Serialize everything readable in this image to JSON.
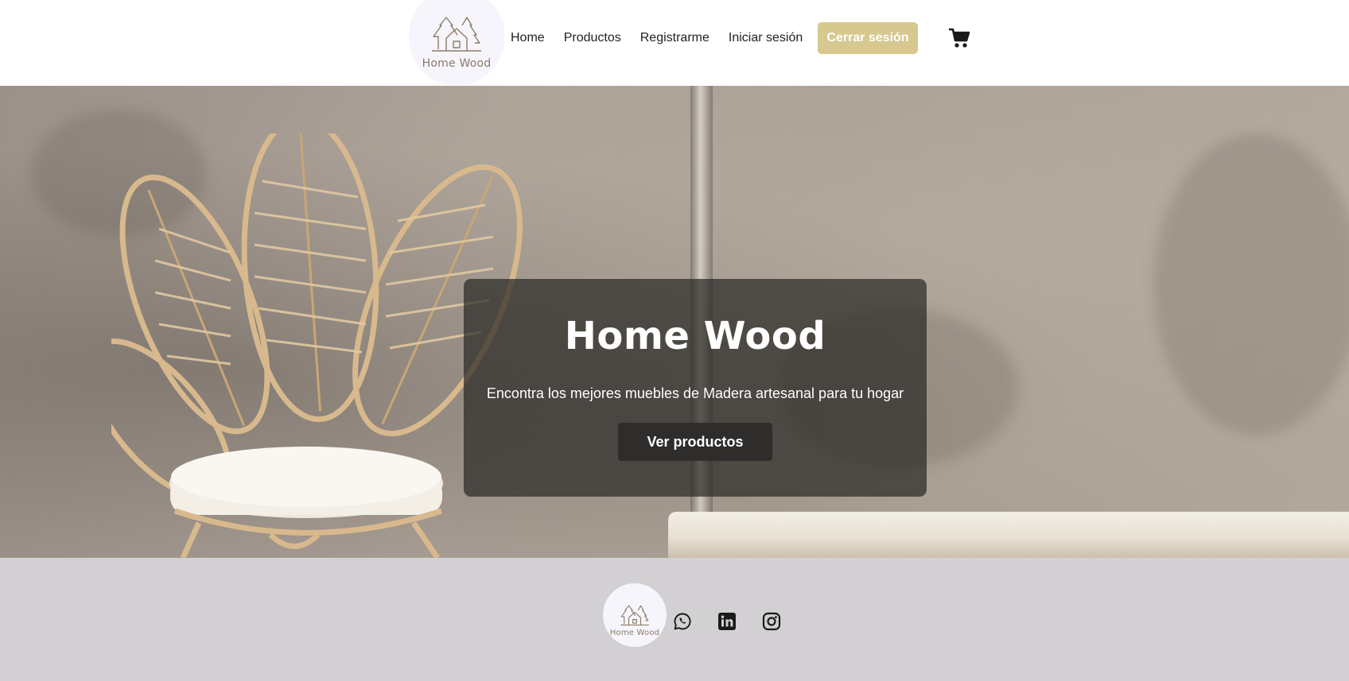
{
  "brand": {
    "name": "Home Wood",
    "accent": "#d6c88e",
    "text_color": "#8a7c68"
  },
  "nav": {
    "items": [
      {
        "label": "Home"
      },
      {
        "label": "Productos"
      },
      {
        "label": "Registrarme"
      },
      {
        "label": "Iniciar sesión"
      }
    ],
    "logout_label": "Cerrar sesión",
    "cart_icon": "shopping-cart-icon"
  },
  "hero": {
    "title": "Home Wood",
    "subtitle": "Encontra los mejores muebles de Madera artesanal para tu hogar",
    "cta_label": "Ver productos"
  },
  "footer": {
    "logo_text": "Home Wood",
    "social": [
      {
        "icon": "whatsapp-icon"
      },
      {
        "icon": "linkedin-icon"
      },
      {
        "icon": "instagram-icon"
      }
    ],
    "background": "#d2d0d2"
  }
}
